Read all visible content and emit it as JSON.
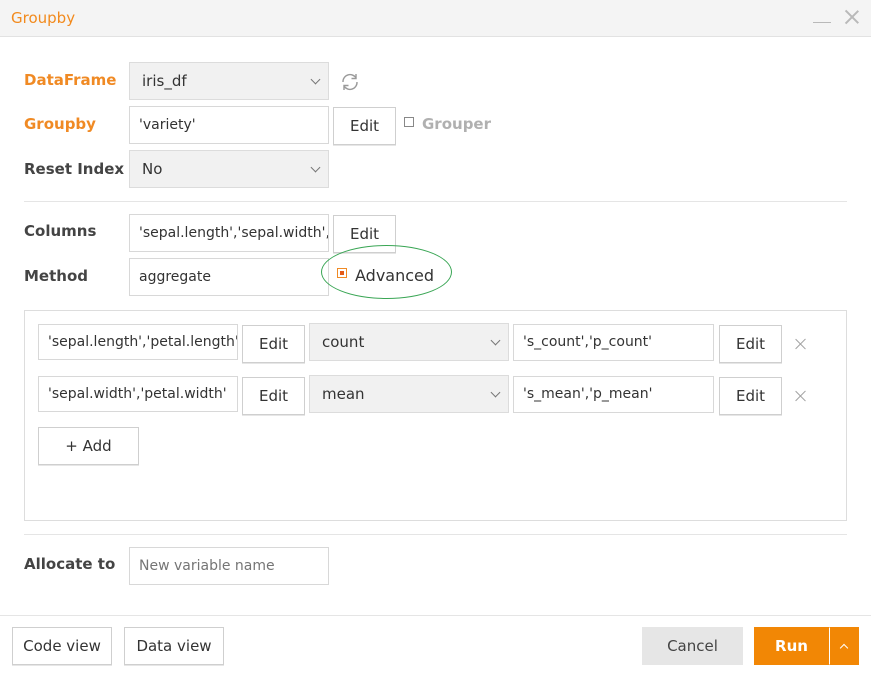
{
  "window": {
    "title": "Groupby"
  },
  "dataframe": {
    "label": "DataFrame",
    "value": "iris_df"
  },
  "groupby": {
    "label": "Groupby",
    "value": "'variety'",
    "edit_label": "Edit",
    "grouper_label": "Grouper"
  },
  "reset_index": {
    "label": "Reset Index",
    "value": "No"
  },
  "columns": {
    "label": "Columns",
    "value": "'sepal.length','sepal.width','",
    "edit_label": "Edit"
  },
  "method": {
    "label": "Method",
    "value": "aggregate",
    "advanced_label": "Advanced"
  },
  "advanced_rows": [
    {
      "columns": "'sepal.length','petal.length'",
      "edit_label": "Edit",
      "func": "count",
      "names": "'s_count','p_count'",
      "names_edit_label": "Edit"
    },
    {
      "columns": "'sepal.width','petal.width'",
      "edit_label": "Edit",
      "func": "mean",
      "names": "'s_mean','p_mean'",
      "names_edit_label": "Edit"
    }
  ],
  "add_label": "+ Add",
  "allocate": {
    "label": "Allocate to",
    "placeholder": "New variable name"
  },
  "footer": {
    "code_view": "Code view",
    "data_view": "Data view",
    "cancel": "Cancel",
    "run": "Run"
  },
  "colors": {
    "accent": "#f28705",
    "label_orange": "#f08a24",
    "highlight_ellipse": "#3aa655"
  }
}
